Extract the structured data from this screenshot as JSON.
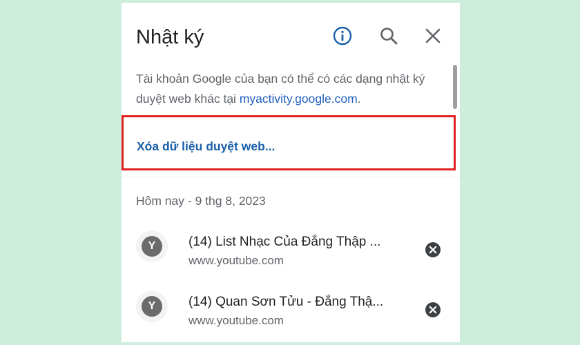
{
  "header": {
    "title": "Nhật ký",
    "info_icon": "info-icon",
    "search_icon": "search-icon",
    "close_icon": "close-icon"
  },
  "info": {
    "text_before_link": "Tài khoản Google của bạn có thể có các dạng nhật ký duyệt web khác tại ",
    "link_text": "myactivity.google.com",
    "text_after_link": "."
  },
  "clear_data": {
    "label": "Xóa dữ liệu duyệt web..."
  },
  "history": {
    "date_header": "Hôm nay - 9 thg 8, 2023",
    "items": [
      {
        "favicon_letter": "Y",
        "title": "(14) List Nhạc Của Đẳng Thập ...",
        "url": "www.youtube.com"
      },
      {
        "favicon_letter": "Y",
        "title": "(14) Quan Sơn Tửu - Đẳng Thậ...",
        "url": "www.youtube.com"
      }
    ]
  },
  "colors": {
    "background": "#cdeedd",
    "highlight_border": "#e02020",
    "link": "#1a5fa8",
    "info_icon": "#1a5fa8"
  }
}
